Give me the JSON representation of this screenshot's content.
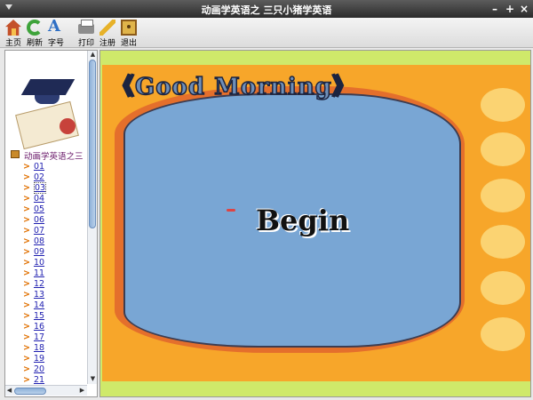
{
  "window": {
    "title": "动画学英语之 三只小猪学英语",
    "minimize": "–",
    "maximize": "+",
    "close": "×"
  },
  "toolbar": {
    "home": "主页",
    "refresh": "刷新",
    "font_size": "字号",
    "print": "打印",
    "register": "注册",
    "exit": "退出"
  },
  "sidebar": {
    "book_title": "动画学英语之三",
    "lesson_marker": ">",
    "lessons": [
      "01",
      "02",
      "03",
      "04",
      "05",
      "06",
      "07",
      "08",
      "09",
      "10",
      "11",
      "12",
      "13",
      "14",
      "15",
      "16",
      "17",
      "18",
      "19",
      "20",
      "21"
    ],
    "selected_lesson": "03"
  },
  "main": {
    "heading": "《Good Morning》",
    "begin_label": "Begin"
  },
  "colors": {
    "title_bar": "#2b2b2b",
    "content_background": "#cfe96a",
    "orange_panel": "#f7a62a",
    "frame": "#e46f2c",
    "board": "#79a6d4",
    "lesson_link": "#1f1fb0",
    "lesson_marker": "#e07000"
  }
}
